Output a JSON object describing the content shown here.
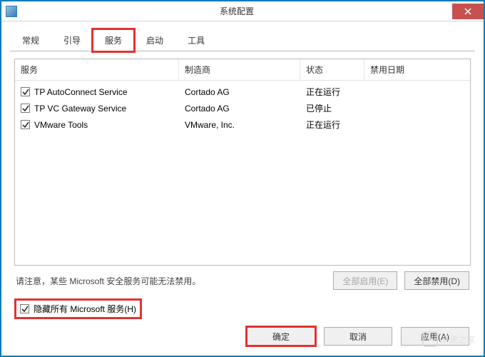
{
  "title": "系统配置",
  "tabs": [
    {
      "label": "常规",
      "active": false
    },
    {
      "label": "引导",
      "active": false
    },
    {
      "label": "服务",
      "active": true,
      "highlight": true
    },
    {
      "label": "启动",
      "active": false
    },
    {
      "label": "工具",
      "active": false
    }
  ],
  "columns": {
    "service": "服务",
    "mfr": "制造商",
    "status": "状态",
    "date": "禁用日期"
  },
  "rows": [
    {
      "checked": true,
      "service": "TP AutoConnect Service",
      "mfr": "Cortado AG",
      "status": "正在运行"
    },
    {
      "checked": true,
      "service": "TP VC Gateway Service",
      "mfr": "Cortado AG",
      "status": "已停止"
    },
    {
      "checked": true,
      "service": "VMware Tools",
      "mfr": "VMware, Inc.",
      "status": "正在运行"
    }
  ],
  "note": "请注意，某些 Microsoft 安全服务可能无法禁用。",
  "buttons": {
    "enable_all": "全部启用(E)",
    "disable_all": "全部禁用(D)",
    "ok": "确定",
    "cancel": "取消",
    "apply": "应用(A)"
  },
  "hide_ms": {
    "checked": true,
    "label": "隐藏所有 Microsoft 服务(H)"
  },
  "watermark": "系统之家"
}
